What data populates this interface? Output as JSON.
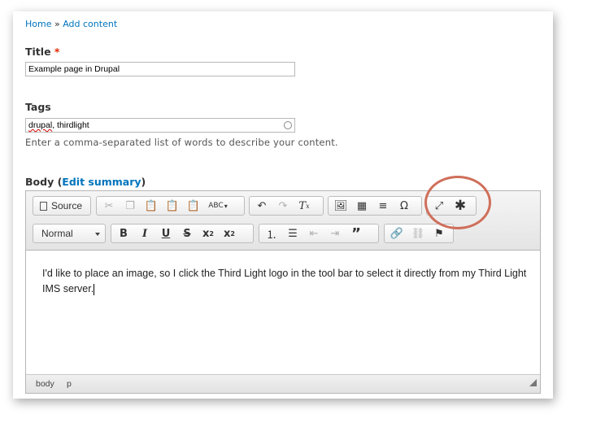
{
  "breadcrumb": {
    "home": "Home",
    "sep": " » ",
    "current": "Add content"
  },
  "title_field": {
    "label": "Title",
    "required_mark": "*",
    "value": "Example page in Drupal"
  },
  "tags_field": {
    "label": "Tags",
    "value_misspelled": "drupal",
    "value_rest": ", thirdlight",
    "help": "Enter a comma-separated list of words to describe your content."
  },
  "body_field": {
    "label": "Body",
    "open_paren": "(",
    "edit_summary": "Edit summary",
    "close_paren": ")"
  },
  "toolbar": {
    "source_label": "Source",
    "format_select": "Normal",
    "icons": [
      "source-icon",
      "cut-icon",
      "copy-icon",
      "paste-icon",
      "paste-text-icon",
      "paste-word-icon",
      "spellcheck-icon",
      "undo-icon",
      "redo-icon",
      "remove-format-icon",
      "image-icon",
      "table-icon",
      "horizontal-rule-icon",
      "special-char-icon",
      "maximize-icon",
      "thirdlight-icon",
      "bold-icon",
      "italic-icon",
      "underline-icon",
      "strikethrough-icon",
      "subscript-icon",
      "superscript-icon",
      "numbered-list-icon",
      "bulleted-list-icon",
      "outdent-icon",
      "indent-icon",
      "blockquote-icon",
      "link-icon",
      "unlink-icon",
      "anchor-icon"
    ]
  },
  "editor_content": "I'd like to place an image, so I click the Third Light logo in the tool bar to select it directly from my Third Light IMS server.",
  "statusbar": {
    "path_body": "body",
    "path_p": "p"
  },
  "colors": {
    "link": "#0074bd",
    "required": "#e32700",
    "highlight": "#cf6f5b"
  }
}
